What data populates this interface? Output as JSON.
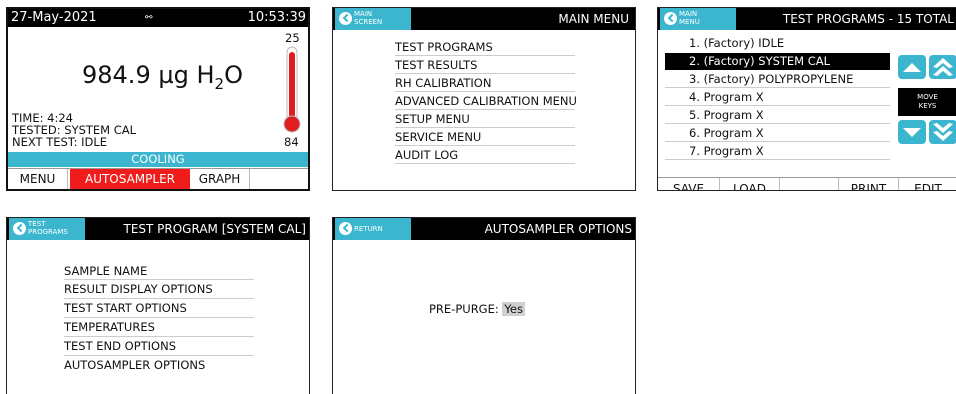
{
  "status_screen": {
    "date": "27-May-2021",
    "status_icon": "link-icon",
    "time": "10:53:39",
    "value": "984.9",
    "unit_prefix": "µg H",
    "unit_sub": "2",
    "unit_suffix": "O",
    "therm_top": "25",
    "therm_bottom": "84",
    "time_line": "TIME: 4:24",
    "tested_line": "TESTED: SYSTEM CAL",
    "next_line": "NEXT TEST: IDLE",
    "status_banner": "COOLING",
    "tabs": [
      "MENU",
      "AUTOSAMPLER",
      "GRAPH"
    ],
    "active_tab_color": "#f01c1c"
  },
  "main_menu": {
    "back_label_1": "MAIN",
    "back_label_2": "SCREEN",
    "title": "MAIN MENU",
    "items": [
      "TEST PROGRAMS",
      "TEST RESULTS",
      "RH CALIBRATION",
      "ADVANCED CALIBRATION MENU",
      "SETUP MENU",
      "SERVICE MENU",
      "AUDIT LOG"
    ]
  },
  "test_programs": {
    "back_label_1": "MAIN",
    "back_label_2": "MENU",
    "title": "TEST PROGRAMS - 15 TOTAL",
    "items": [
      "1. (Factory) IDLE",
      "2. (Factory) SYSTEM CAL",
      "3. (Factory) POLYPROPYLENE",
      "4. Program X",
      "5. Program X",
      "6. Program X",
      "7. Program X"
    ],
    "selected_index": 1,
    "move_keys_1": "MOVE",
    "move_keys_2": "KEYS",
    "buttons": [
      "SAVE",
      "LOAD",
      "",
      "PRINT",
      "EDIT"
    ]
  },
  "test_program_detail": {
    "back_label_1": "TEST",
    "back_label_2": "PROGRAMS",
    "title": "TEST PROGRAM [SYSTEM CAL]",
    "items": [
      "SAMPLE NAME",
      "RESULT DISPLAY OPTIONS",
      "TEST START OPTIONS",
      "TEMPERATURES",
      "TEST END OPTIONS",
      "AUTOSAMPLER OPTIONS"
    ]
  },
  "autosampler_options": {
    "back_label": "RETURN",
    "title": "AUTOSAMPLER OPTIONS",
    "field_label": "PRE-PURGE:",
    "field_value": "Yes"
  },
  "colors": {
    "accent": "#3cb6cf",
    "alert": "#f01c1c",
    "header": "#000000"
  }
}
